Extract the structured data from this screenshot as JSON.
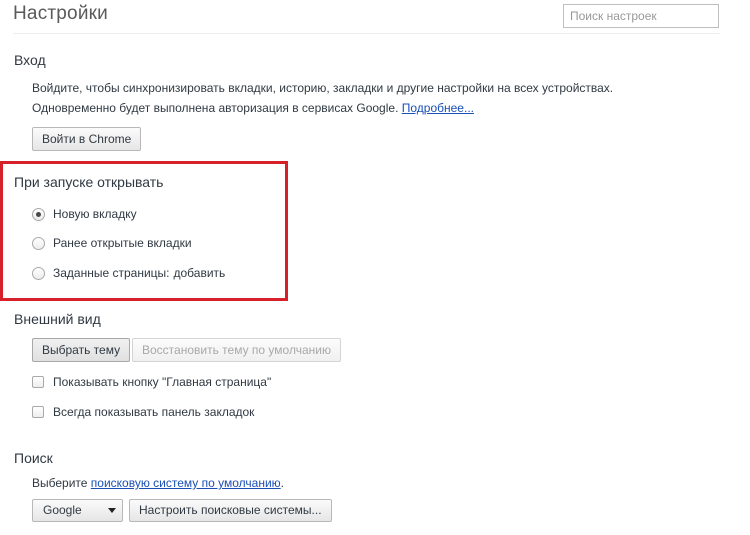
{
  "page": {
    "title": "Настройки",
    "search_placeholder": "Поиск настроек"
  },
  "signin": {
    "title": "Вход",
    "description": "Войдите, чтобы синхронизировать вкладки, историю, закладки и другие настройки на всех устройствах.",
    "note": "Одновременно будет выполнена авторизация в сервисах Google.",
    "more_link": "Подробнее...",
    "button": "Войти в Chrome"
  },
  "startup": {
    "title": "При запуске открывать",
    "options": [
      {
        "label": "Новую вкладку",
        "checked": true
      },
      {
        "label": "Ранее открытые вкладки",
        "checked": false
      },
      {
        "label": "Заданные страницы:",
        "checked": false
      }
    ],
    "add_link": "добавить",
    "highlight_color": "#d6202a"
  },
  "appearance": {
    "title": "Внешний вид",
    "choose_theme_button": "Выбрать тему",
    "reset_theme_button": "Восстановить тему по умолчанию",
    "checkboxes": [
      {
        "label": "Показывать кнопку \"Главная страница\"",
        "checked": false
      },
      {
        "label": "Всегда показывать панель закладок",
        "checked": false
      }
    ]
  },
  "search": {
    "title": "Поиск",
    "prefix": "Выберите",
    "engine_link": "поисковую систему по умолчанию",
    "suffix": ".",
    "engine_selected": "Google",
    "manage_button": "Настроить поисковые системы..."
  },
  "colors": {
    "link": "#1a4fb5",
    "text": "#303942",
    "title": "#5a5a5a"
  }
}
